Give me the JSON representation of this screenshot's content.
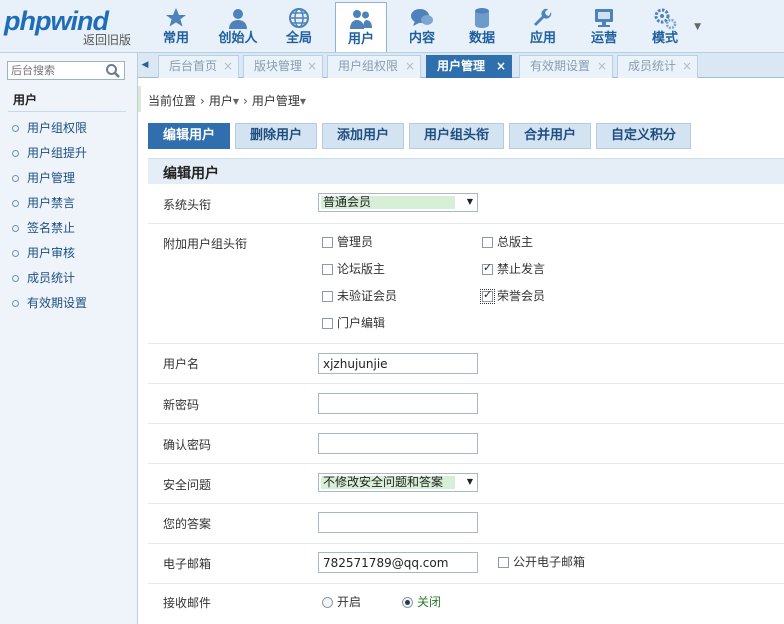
{
  "logo": {
    "brand": "phpwind",
    "sub": "返回旧版"
  },
  "topnav": [
    {
      "label": "常用",
      "icon": "star-icon"
    },
    {
      "label": "创始人",
      "icon": "founder-person-icon"
    },
    {
      "label": "全局",
      "icon": "globe-icon"
    },
    {
      "label": "用户",
      "icon": "users-icon",
      "active": true
    },
    {
      "label": "内容",
      "icon": "chat-bubbles-icon"
    },
    {
      "label": "数据",
      "icon": "database-icon"
    },
    {
      "label": "应用",
      "icon": "wrench-icon"
    },
    {
      "label": "运营",
      "icon": "monitor-icon"
    },
    {
      "label": "模式",
      "icon": "gears-icon"
    }
  ],
  "tabs": [
    {
      "label": "后台首页"
    },
    {
      "label": "版块管理"
    },
    {
      "label": "用户组权限"
    },
    {
      "label": "用户管理",
      "active": true
    },
    {
      "label": "有效期设置"
    },
    {
      "label": "成员统计"
    }
  ],
  "sidebar": {
    "search_placeholder": "后台搜索",
    "title": "用户",
    "items": [
      "用户组权限",
      "用户组提升",
      "用户管理",
      "用户禁言",
      "签名禁止",
      "用户审核",
      "成员统计",
      "有效期设置"
    ]
  },
  "breadcrumb": {
    "prefix": "当前位置",
    "level1": "用户",
    "level2": "用户管理"
  },
  "actions": [
    "编辑用户",
    "删除用户",
    "添加用户",
    "用户组头衔",
    "合并用户",
    "自定义积分"
  ],
  "section_title": "编辑用户",
  "form": {
    "system_title": {
      "label": "系统头衔",
      "value": "普通会员"
    },
    "extra_groups": {
      "label": "附加用户组头衔",
      "options": [
        {
          "label": "管理员",
          "checked": false
        },
        {
          "label": "总版主",
          "checked": false
        },
        {
          "label": "论坛版主",
          "checked": false
        },
        {
          "label": "禁止发言",
          "checked": true
        },
        {
          "label": "未验证会员",
          "checked": false
        },
        {
          "label": "荣誉会员",
          "checked": true
        },
        {
          "label": "门户编辑",
          "checked": false
        }
      ]
    },
    "username": {
      "label": "用户名",
      "value": "xjzhujunjie"
    },
    "new_password": {
      "label": "新密码",
      "value": ""
    },
    "confirm_password": {
      "label": "确认密码",
      "value": ""
    },
    "security_question": {
      "label": "安全问题",
      "value": "不修改安全问题和答案"
    },
    "answer": {
      "label": "您的答案",
      "value": ""
    },
    "email": {
      "label": "电子邮箱",
      "value": "782571789@qq.com",
      "public_label": "公开电子邮箱",
      "public_checked": false
    },
    "receive_mail": {
      "label": "接收邮件",
      "on_label": "开启",
      "off_label": "关闭",
      "selected": "off"
    }
  }
}
